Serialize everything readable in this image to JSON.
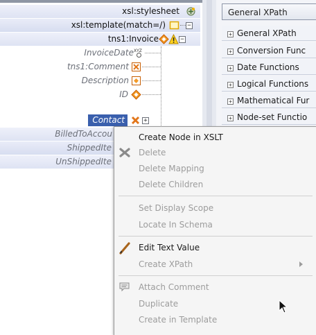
{
  "tree": {
    "root": "xsl:stylesheet",
    "template": "xsl:template(match=/)",
    "invoice": "tns1:Invoice",
    "fields": {
      "invoice_date": "InvoiceDate",
      "comment": "tns1:Comment",
      "description": "Description",
      "id": "ID",
      "contact": "Contact",
      "billed_to": "BilledToAccou",
      "shipped": "ShippedIte",
      "unshipped": "UnShippedIte"
    }
  },
  "xpath": {
    "header": "General XPath",
    "categories": [
      "General XPath",
      "Conversion Func",
      "Date Functions",
      "Logical Functions",
      "Mathematical Fur",
      "Node-set Functio"
    ]
  },
  "menu": {
    "items": [
      {
        "label": "Create Node in XSLT",
        "enabled": true
      },
      {
        "label": "Delete",
        "enabled": false
      },
      {
        "label": "Delete Mapping",
        "enabled": false
      },
      {
        "label": "Delete Children",
        "enabled": false
      },
      {
        "label": "Set Display Scope",
        "enabled": false
      },
      {
        "label": "Locate In Schema",
        "enabled": false
      },
      {
        "label": "Edit Text Value",
        "enabled": true
      },
      {
        "label": "Create XPath",
        "enabled": false
      },
      {
        "label": "Attach Comment",
        "enabled": false
      },
      {
        "label": "Duplicate",
        "enabled": false
      },
      {
        "label": "Create in Template",
        "enabled": false
      }
    ]
  },
  "colors": {
    "selection": "#3a5fad",
    "row_band": "#dee3f3",
    "menu_bg": "#f5f5f5",
    "disabled_text": "#9c9c9c"
  },
  "icons": {
    "stylesheet": "stylesheet-icon",
    "template": "template-icon",
    "invoice": "element-icon",
    "warning": "warning-icon",
    "xyz": "xyz-type-icon",
    "delete": "delete-x-icon",
    "edit": "pencil-icon",
    "comment": "comment-icon",
    "submenu": "chevron-right-icon"
  }
}
